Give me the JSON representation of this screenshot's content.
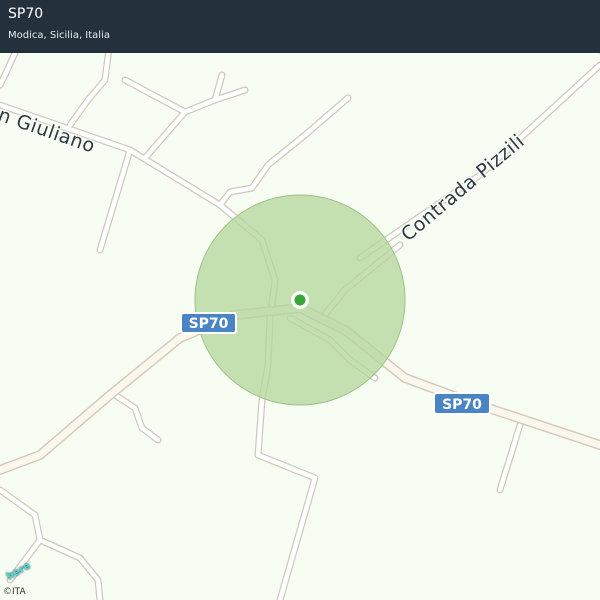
{
  "header": {
    "title": "SP70",
    "subtitle": "Modica, Sicilia, Italia"
  },
  "map": {
    "road_labels": {
      "giuliano": "n  Giuliano",
      "contrada_pizzili": "Contrada Pizzili"
    },
    "route_shields": [
      "SP70",
      "SP70"
    ],
    "colors": {
      "background": "#f8fdf3",
      "accuracy_circle": "#b5d69c",
      "location_dot": "#3aa63a",
      "shield": "#4a84c4"
    }
  },
  "footer": {
    "logo_text": "here",
    "copyright": "©ITA"
  }
}
